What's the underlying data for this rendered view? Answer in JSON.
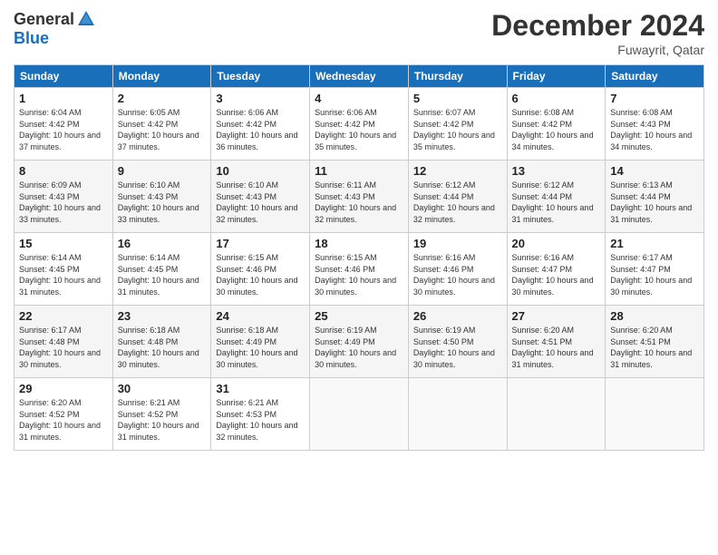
{
  "header": {
    "logo_general": "General",
    "logo_blue": "Blue",
    "title": "December 2024",
    "location": "Fuwayrit, Qatar"
  },
  "weekdays": [
    "Sunday",
    "Monday",
    "Tuesday",
    "Wednesday",
    "Thursday",
    "Friday",
    "Saturday"
  ],
  "weeks": [
    [
      {
        "day": "1",
        "sunrise": "6:04 AM",
        "sunset": "4:42 PM",
        "daylight": "10 hours and 37 minutes."
      },
      {
        "day": "2",
        "sunrise": "6:05 AM",
        "sunset": "4:42 PM",
        "daylight": "10 hours and 37 minutes."
      },
      {
        "day": "3",
        "sunrise": "6:06 AM",
        "sunset": "4:42 PM",
        "daylight": "10 hours and 36 minutes."
      },
      {
        "day": "4",
        "sunrise": "6:06 AM",
        "sunset": "4:42 PM",
        "daylight": "10 hours and 35 minutes."
      },
      {
        "day": "5",
        "sunrise": "6:07 AM",
        "sunset": "4:42 PM",
        "daylight": "10 hours and 35 minutes."
      },
      {
        "day": "6",
        "sunrise": "6:08 AM",
        "sunset": "4:42 PM",
        "daylight": "10 hours and 34 minutes."
      },
      {
        "day": "7",
        "sunrise": "6:08 AM",
        "sunset": "4:43 PM",
        "daylight": "10 hours and 34 minutes."
      }
    ],
    [
      {
        "day": "8",
        "sunrise": "6:09 AM",
        "sunset": "4:43 PM",
        "daylight": "10 hours and 33 minutes."
      },
      {
        "day": "9",
        "sunrise": "6:10 AM",
        "sunset": "4:43 PM",
        "daylight": "10 hours and 33 minutes."
      },
      {
        "day": "10",
        "sunrise": "6:10 AM",
        "sunset": "4:43 PM",
        "daylight": "10 hours and 32 minutes."
      },
      {
        "day": "11",
        "sunrise": "6:11 AM",
        "sunset": "4:43 PM",
        "daylight": "10 hours and 32 minutes."
      },
      {
        "day": "12",
        "sunrise": "6:12 AM",
        "sunset": "4:44 PM",
        "daylight": "10 hours and 32 minutes."
      },
      {
        "day": "13",
        "sunrise": "6:12 AM",
        "sunset": "4:44 PM",
        "daylight": "10 hours and 31 minutes."
      },
      {
        "day": "14",
        "sunrise": "6:13 AM",
        "sunset": "4:44 PM",
        "daylight": "10 hours and 31 minutes."
      }
    ],
    [
      {
        "day": "15",
        "sunrise": "6:14 AM",
        "sunset": "4:45 PM",
        "daylight": "10 hours and 31 minutes."
      },
      {
        "day": "16",
        "sunrise": "6:14 AM",
        "sunset": "4:45 PM",
        "daylight": "10 hours and 31 minutes."
      },
      {
        "day": "17",
        "sunrise": "6:15 AM",
        "sunset": "4:46 PM",
        "daylight": "10 hours and 30 minutes."
      },
      {
        "day": "18",
        "sunrise": "6:15 AM",
        "sunset": "4:46 PM",
        "daylight": "10 hours and 30 minutes."
      },
      {
        "day": "19",
        "sunrise": "6:16 AM",
        "sunset": "4:46 PM",
        "daylight": "10 hours and 30 minutes."
      },
      {
        "day": "20",
        "sunrise": "6:16 AM",
        "sunset": "4:47 PM",
        "daylight": "10 hours and 30 minutes."
      },
      {
        "day": "21",
        "sunrise": "6:17 AM",
        "sunset": "4:47 PM",
        "daylight": "10 hours and 30 minutes."
      }
    ],
    [
      {
        "day": "22",
        "sunrise": "6:17 AM",
        "sunset": "4:48 PM",
        "daylight": "10 hours and 30 minutes."
      },
      {
        "day": "23",
        "sunrise": "6:18 AM",
        "sunset": "4:48 PM",
        "daylight": "10 hours and 30 minutes."
      },
      {
        "day": "24",
        "sunrise": "6:18 AM",
        "sunset": "4:49 PM",
        "daylight": "10 hours and 30 minutes."
      },
      {
        "day": "25",
        "sunrise": "6:19 AM",
        "sunset": "4:49 PM",
        "daylight": "10 hours and 30 minutes."
      },
      {
        "day": "26",
        "sunrise": "6:19 AM",
        "sunset": "4:50 PM",
        "daylight": "10 hours and 30 minutes."
      },
      {
        "day": "27",
        "sunrise": "6:20 AM",
        "sunset": "4:51 PM",
        "daylight": "10 hours and 31 minutes."
      },
      {
        "day": "28",
        "sunrise": "6:20 AM",
        "sunset": "4:51 PM",
        "daylight": "10 hours and 31 minutes."
      }
    ],
    [
      {
        "day": "29",
        "sunrise": "6:20 AM",
        "sunset": "4:52 PM",
        "daylight": "10 hours and 31 minutes."
      },
      {
        "day": "30",
        "sunrise": "6:21 AM",
        "sunset": "4:52 PM",
        "daylight": "10 hours and 31 minutes."
      },
      {
        "day": "31",
        "sunrise": "6:21 AM",
        "sunset": "4:53 PM",
        "daylight": "10 hours and 32 minutes."
      },
      null,
      null,
      null,
      null
    ]
  ]
}
